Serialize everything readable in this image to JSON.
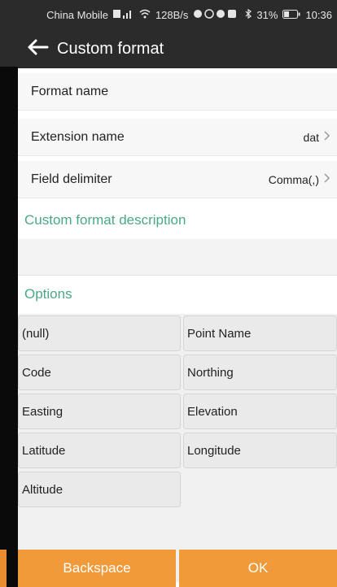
{
  "status_bar": {
    "carrier": "China Mobile",
    "network_speed": "128B/s",
    "battery": "31%",
    "time": "10:36"
  },
  "app_bar": {
    "title": "Custom format"
  },
  "form": {
    "format_name_label": "Format name",
    "extension_label": "Extension name",
    "extension_value": "dat",
    "delimiter_label": "Field delimiter",
    "delimiter_value": "Comma(,)"
  },
  "sections": {
    "description_title": "Custom format description",
    "options_title": "Options"
  },
  "options": [
    "(null)",
    "Point Name",
    "Code",
    "Northing",
    "Easting",
    "Elevation",
    "Latitude",
    "Longitude",
    "Altitude"
  ],
  "buttons": {
    "backspace": "Backspace",
    "ok": "OK"
  },
  "colors": {
    "accent_green": "#4aa885",
    "button_orange": "#f09a3a",
    "app_bar": "#2b2b2b"
  }
}
